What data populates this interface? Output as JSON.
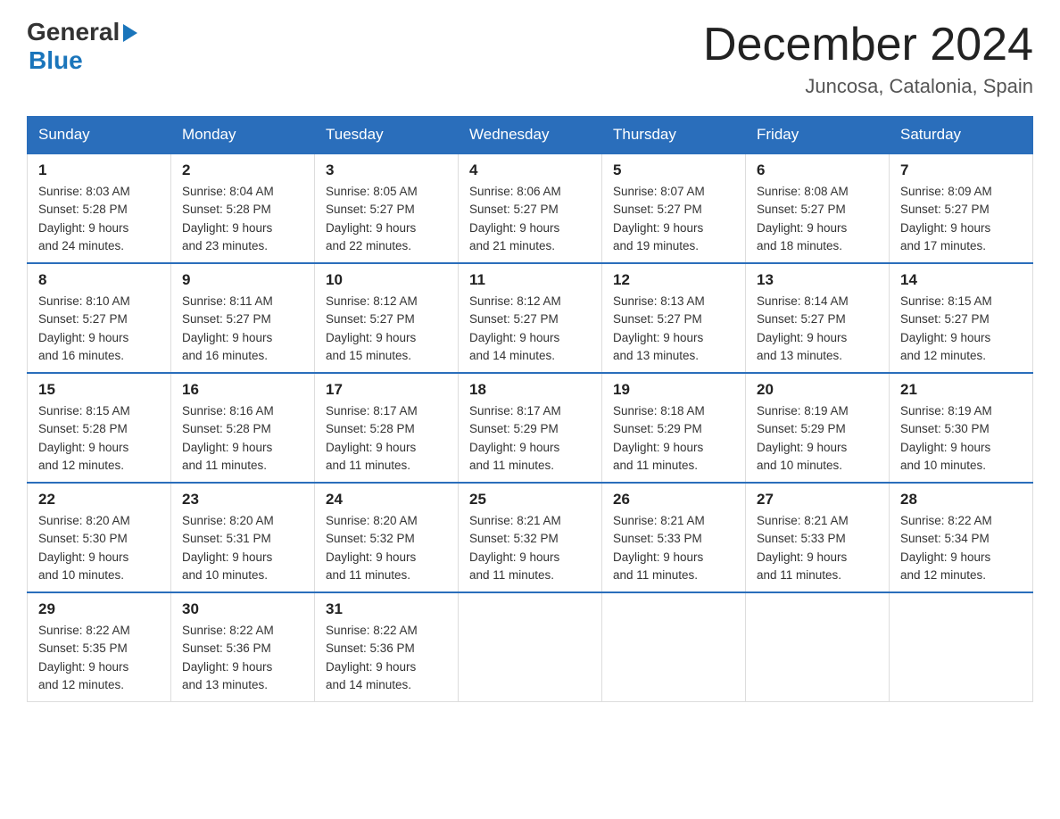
{
  "header": {
    "logo_general": "General",
    "logo_blue": "Blue",
    "title": "December 2024",
    "subtitle": "Juncosa, Catalonia, Spain"
  },
  "weekdays": [
    "Sunday",
    "Monday",
    "Tuesday",
    "Wednesday",
    "Thursday",
    "Friday",
    "Saturday"
  ],
  "weeks": [
    [
      {
        "day": "1",
        "sunrise": "8:03 AM",
        "sunset": "5:28 PM",
        "daylight": "9 hours and 24 minutes."
      },
      {
        "day": "2",
        "sunrise": "8:04 AM",
        "sunset": "5:28 PM",
        "daylight": "9 hours and 23 minutes."
      },
      {
        "day": "3",
        "sunrise": "8:05 AM",
        "sunset": "5:27 PM",
        "daylight": "9 hours and 22 minutes."
      },
      {
        "day": "4",
        "sunrise": "8:06 AM",
        "sunset": "5:27 PM",
        "daylight": "9 hours and 21 minutes."
      },
      {
        "day": "5",
        "sunrise": "8:07 AM",
        "sunset": "5:27 PM",
        "daylight": "9 hours and 19 minutes."
      },
      {
        "day": "6",
        "sunrise": "8:08 AM",
        "sunset": "5:27 PM",
        "daylight": "9 hours and 18 minutes."
      },
      {
        "day": "7",
        "sunrise": "8:09 AM",
        "sunset": "5:27 PM",
        "daylight": "9 hours and 17 minutes."
      }
    ],
    [
      {
        "day": "8",
        "sunrise": "8:10 AM",
        "sunset": "5:27 PM",
        "daylight": "9 hours and 16 minutes."
      },
      {
        "day": "9",
        "sunrise": "8:11 AM",
        "sunset": "5:27 PM",
        "daylight": "9 hours and 16 minutes."
      },
      {
        "day": "10",
        "sunrise": "8:12 AM",
        "sunset": "5:27 PM",
        "daylight": "9 hours and 15 minutes."
      },
      {
        "day": "11",
        "sunrise": "8:12 AM",
        "sunset": "5:27 PM",
        "daylight": "9 hours and 14 minutes."
      },
      {
        "day": "12",
        "sunrise": "8:13 AM",
        "sunset": "5:27 PM",
        "daylight": "9 hours and 13 minutes."
      },
      {
        "day": "13",
        "sunrise": "8:14 AM",
        "sunset": "5:27 PM",
        "daylight": "9 hours and 13 minutes."
      },
      {
        "day": "14",
        "sunrise": "8:15 AM",
        "sunset": "5:27 PM",
        "daylight": "9 hours and 12 minutes."
      }
    ],
    [
      {
        "day": "15",
        "sunrise": "8:15 AM",
        "sunset": "5:28 PM",
        "daylight": "9 hours and 12 minutes."
      },
      {
        "day": "16",
        "sunrise": "8:16 AM",
        "sunset": "5:28 PM",
        "daylight": "9 hours and 11 minutes."
      },
      {
        "day": "17",
        "sunrise": "8:17 AM",
        "sunset": "5:28 PM",
        "daylight": "9 hours and 11 minutes."
      },
      {
        "day": "18",
        "sunrise": "8:17 AM",
        "sunset": "5:29 PM",
        "daylight": "9 hours and 11 minutes."
      },
      {
        "day": "19",
        "sunrise": "8:18 AM",
        "sunset": "5:29 PM",
        "daylight": "9 hours and 11 minutes."
      },
      {
        "day": "20",
        "sunrise": "8:19 AM",
        "sunset": "5:29 PM",
        "daylight": "9 hours and 10 minutes."
      },
      {
        "day": "21",
        "sunrise": "8:19 AM",
        "sunset": "5:30 PM",
        "daylight": "9 hours and 10 minutes."
      }
    ],
    [
      {
        "day": "22",
        "sunrise": "8:20 AM",
        "sunset": "5:30 PM",
        "daylight": "9 hours and 10 minutes."
      },
      {
        "day": "23",
        "sunrise": "8:20 AM",
        "sunset": "5:31 PM",
        "daylight": "9 hours and 10 minutes."
      },
      {
        "day": "24",
        "sunrise": "8:20 AM",
        "sunset": "5:32 PM",
        "daylight": "9 hours and 11 minutes."
      },
      {
        "day": "25",
        "sunrise": "8:21 AM",
        "sunset": "5:32 PM",
        "daylight": "9 hours and 11 minutes."
      },
      {
        "day": "26",
        "sunrise": "8:21 AM",
        "sunset": "5:33 PM",
        "daylight": "9 hours and 11 minutes."
      },
      {
        "day": "27",
        "sunrise": "8:21 AM",
        "sunset": "5:33 PM",
        "daylight": "9 hours and 11 minutes."
      },
      {
        "day": "28",
        "sunrise": "8:22 AM",
        "sunset": "5:34 PM",
        "daylight": "9 hours and 12 minutes."
      }
    ],
    [
      {
        "day": "29",
        "sunrise": "8:22 AM",
        "sunset": "5:35 PM",
        "daylight": "9 hours and 12 minutes."
      },
      {
        "day": "30",
        "sunrise": "8:22 AM",
        "sunset": "5:36 PM",
        "daylight": "9 hours and 13 minutes."
      },
      {
        "day": "31",
        "sunrise": "8:22 AM",
        "sunset": "5:36 PM",
        "daylight": "9 hours and 14 minutes."
      },
      null,
      null,
      null,
      null
    ]
  ],
  "labels": {
    "sunrise": "Sunrise:",
    "sunset": "Sunset:",
    "daylight": "Daylight:"
  }
}
